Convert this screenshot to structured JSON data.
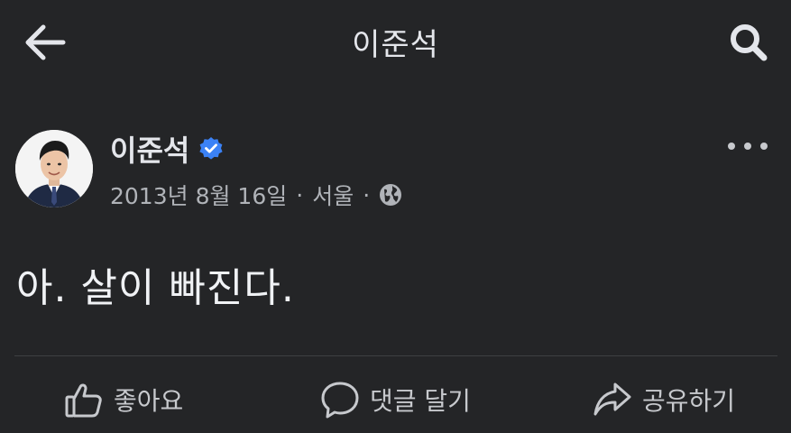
{
  "header": {
    "title": "이준석",
    "back_icon": "arrow-left-icon",
    "search_icon": "search-icon"
  },
  "post": {
    "author": "이준석",
    "verified": true,
    "date": "2013년 8월 16일",
    "location": "서울",
    "privacy_icon": "globe-icon",
    "text": "아. 살이 빠진다."
  },
  "actions": {
    "like": "좋아요",
    "comment": "댓글 달기",
    "share": "공유하기"
  },
  "colors": {
    "background": "#242527",
    "text_primary": "#e4e6eb",
    "text_secondary": "#b0b3b8",
    "verified": "#3b82f6",
    "divider": "#3e4042"
  }
}
